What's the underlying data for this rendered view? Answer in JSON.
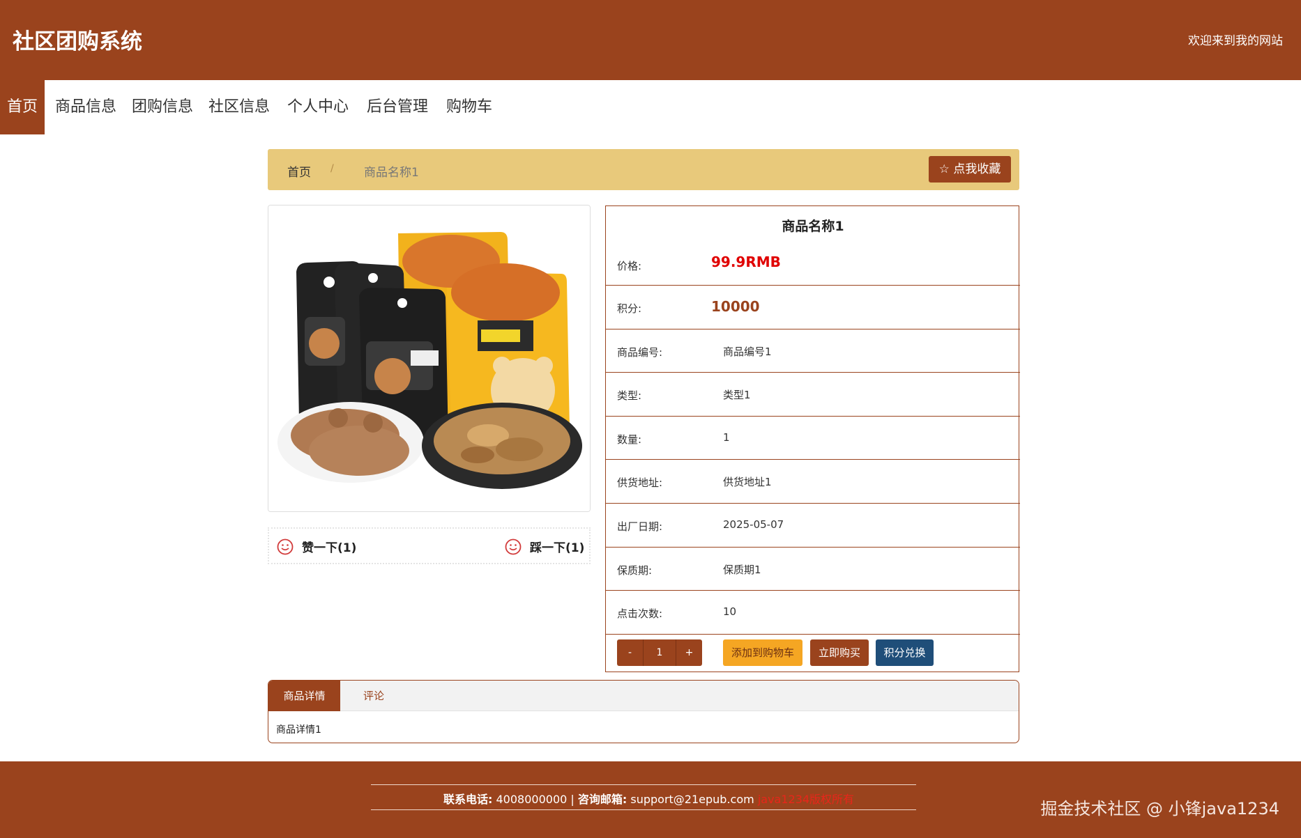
{
  "header": {
    "site_title": "社区团购系统",
    "welcome": "欢迎来到我的网站"
  },
  "nav": {
    "items": [
      {
        "label": "首页",
        "active": true
      },
      {
        "label": "商品信息"
      },
      {
        "label": "团购信息"
      },
      {
        "label": "社区信息"
      },
      {
        "label": "个人中心"
      },
      {
        "label": "后台管理"
      },
      {
        "label": "购物车"
      }
    ]
  },
  "breadcrumb": {
    "home": "首页",
    "separator": "/",
    "current": "商品名称1",
    "favorite_button": "点我收藏",
    "favorite_icon": "star-outline-icon"
  },
  "votes": {
    "like_label": "赞一下(1)",
    "dislike_label": "踩一下(1)",
    "icon": "smiley-face-icon"
  },
  "product": {
    "name": "商品名称1",
    "price_label": "价格:",
    "price_value": "99.9RMB",
    "points_label": "积分:",
    "points_value": "10000",
    "fields": [
      {
        "label": "商品编号:",
        "value": "商品编号1"
      },
      {
        "label": "类型:",
        "value": "类型1"
      },
      {
        "label": "数量:",
        "value": "1"
      },
      {
        "label": "供货地址:",
        "value": "供货地址1"
      },
      {
        "label": "出厂日期:",
        "value": "2025-05-07"
      },
      {
        "label": "保质期:",
        "value": "保质期1"
      },
      {
        "label": "点击次数:",
        "value": "10"
      }
    ]
  },
  "actions": {
    "minus": "-",
    "quantity": "1",
    "plus": "+",
    "add_to_cart": "添加到购物车",
    "buy_now": "立即购买",
    "points_exchange": "积分兑换"
  },
  "tabs": {
    "detail": "商品详情",
    "comment": "评论",
    "content": "商品详情1"
  },
  "footer": {
    "phone_label": "联系电话:",
    "phone": "4008000000",
    "divider": "|",
    "email_label": "咨询邮箱:",
    "email": "support@21epub.com",
    "icp": "java1234版权所有",
    "watermark": "掘金技术社区 @ 小锋java1234"
  },
  "colors": {
    "brand": "#9a431d",
    "breadcrumb_bg": "#e8c97b",
    "price": "#e00000",
    "cart_button": "#f5a623",
    "exchange_button": "#1f4e79"
  }
}
